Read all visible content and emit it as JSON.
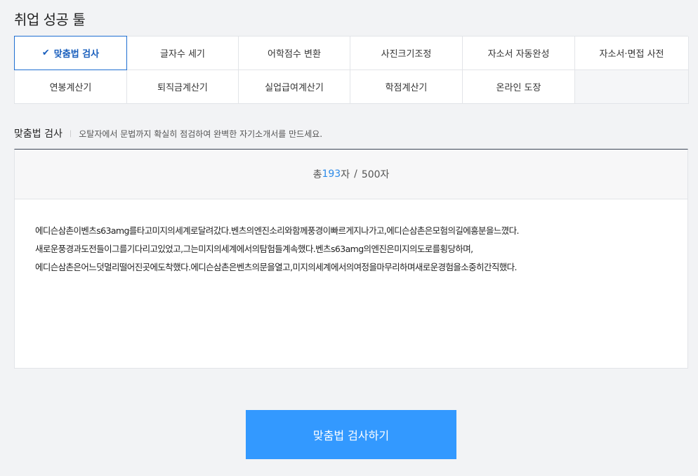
{
  "header": {
    "title": "취업 성공 툴"
  },
  "tabs": {
    "row1": [
      {
        "label": "맞춤법 검사",
        "active": true
      },
      {
        "label": "글자수 세기"
      },
      {
        "label": "어학점수 변환"
      },
      {
        "label": "사진크기조정"
      },
      {
        "label": "자소서 자동완성"
      },
      {
        "label": "자소서·면접 사전"
      }
    ],
    "row2": [
      {
        "label": "연봉계산기"
      },
      {
        "label": "퇴직금계산기"
      },
      {
        "label": "실업급여계산기"
      },
      {
        "label": "학점계산기"
      },
      {
        "label": "온라인 도장"
      }
    ],
    "active_icon": "check-icon"
  },
  "section": {
    "title": "맞춤법 검사",
    "separator": "|",
    "description": "오탈자에서 문법까지 확실히 점검하여 완벽한 자기소개서를 만드세요."
  },
  "counter": {
    "prefix": "총 ",
    "count": "193",
    "unit": "자",
    "slash": "/",
    "max": "500자"
  },
  "editor": {
    "text": "에디슨삼촌이벤츠s63amg를타고미지의세계로달려갔다.벤츠의엔진소리와함께풍경이빠르게지나가고,에디슨삼촌은모험의길에흥분을느꼈다.\n새로운풍경과도전들이그를기다리고있었고,그는미지의세계에서의탐험들계속했다.벤츠s63amg의엔진은미지의도로를횡당하며,\n에디슨삼촌은어느덧멀리떨어진곳에도착했다.에디슨삼촌은벤츠의문을열고,미지의세계에서의여정을마무리하며새로운경험을소중히간직했다."
  },
  "submit": {
    "label": "맞춤법 검사하기"
  },
  "colors": {
    "accent": "#3399ff",
    "active_tab": "#1f6fd1",
    "count": "#2c8ae8"
  }
}
